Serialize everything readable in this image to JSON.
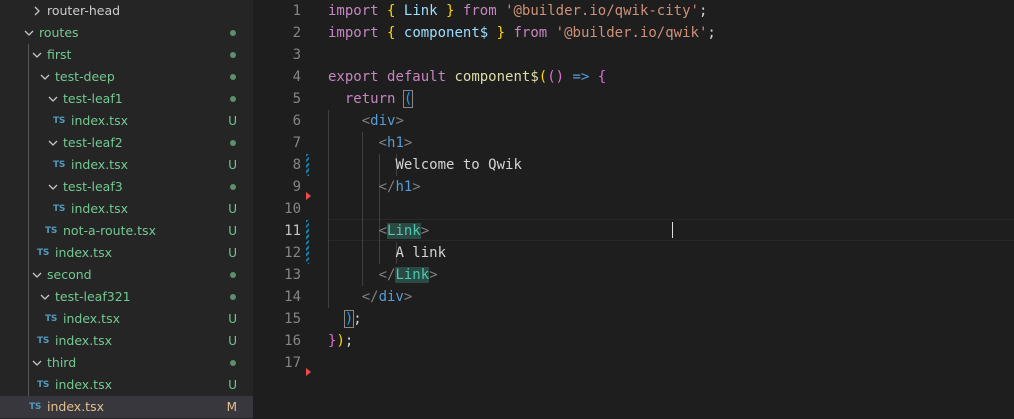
{
  "explorer": {
    "items": [
      {
        "label": "router-head",
        "kind": "folder",
        "expanded": false,
        "depth": 1,
        "state": "plain",
        "badge": ""
      },
      {
        "label": "routes",
        "kind": "folder",
        "expanded": true,
        "depth": 1,
        "state": "folder",
        "badge": "dot"
      },
      {
        "label": "first",
        "kind": "folder",
        "expanded": true,
        "depth": 2,
        "state": "folder",
        "badge": "dot"
      },
      {
        "label": "test-deep",
        "kind": "folder",
        "expanded": true,
        "depth": 3,
        "state": "folder",
        "badge": "dot"
      },
      {
        "label": "test-leaf1",
        "kind": "folder",
        "expanded": true,
        "depth": 4,
        "state": "folder",
        "badge": "dot"
      },
      {
        "label": "index.tsx",
        "kind": "file",
        "icon": "TS",
        "depth": 5,
        "state": "untracked",
        "badge": "U"
      },
      {
        "label": "test-leaf2",
        "kind": "folder",
        "expanded": true,
        "depth": 4,
        "state": "folder",
        "badge": "dot"
      },
      {
        "label": "index.tsx",
        "kind": "file",
        "icon": "TS",
        "depth": 5,
        "state": "untracked",
        "badge": "U"
      },
      {
        "label": "test-leaf3",
        "kind": "folder",
        "expanded": true,
        "depth": 4,
        "state": "folder",
        "badge": "dot"
      },
      {
        "label": "index.tsx",
        "kind": "file",
        "icon": "TS",
        "depth": 5,
        "state": "untracked",
        "badge": "U"
      },
      {
        "label": "not-a-route.tsx",
        "kind": "file",
        "icon": "TS",
        "depth": 4,
        "state": "untracked",
        "badge": "U"
      },
      {
        "label": "index.tsx",
        "kind": "file",
        "icon": "TS",
        "depth": 3,
        "state": "untracked",
        "badge": "U"
      },
      {
        "label": "second",
        "kind": "folder",
        "expanded": true,
        "depth": 2,
        "state": "folder",
        "badge": "dot"
      },
      {
        "label": "test-leaf321",
        "kind": "folder",
        "expanded": true,
        "depth": 3,
        "state": "folder",
        "badge": "dot"
      },
      {
        "label": "index.tsx",
        "kind": "file",
        "icon": "TS",
        "depth": 4,
        "state": "untracked",
        "badge": "U"
      },
      {
        "label": "index.tsx",
        "kind": "file",
        "icon": "TS",
        "depth": 3,
        "state": "untracked",
        "badge": "U"
      },
      {
        "label": "third",
        "kind": "folder",
        "expanded": true,
        "depth": 2,
        "state": "folder",
        "badge": "dot"
      },
      {
        "label": "index.tsx",
        "kind": "file",
        "icon": "TS",
        "depth": 3,
        "state": "untracked",
        "badge": "U"
      },
      {
        "label": "index.tsx",
        "kind": "file",
        "icon": "TS",
        "depth": 2,
        "state": "modified",
        "badge": "M",
        "selected": true
      }
    ]
  },
  "editor": {
    "language": "tsx",
    "active_line": 11,
    "line_numbers": [
      "1",
      "2",
      "3",
      "4",
      "5",
      "6",
      "7",
      "8",
      "9",
      "10",
      "11",
      "12",
      "13",
      "14",
      "15",
      "16",
      "17"
    ],
    "lines": [
      "import { Link } from '@builder.io/qwik-city';",
      "import { component$ } from '@builder.io/qwik';",
      "",
      "export default component$(() => {",
      "  return (",
      "    <div>",
      "      <h1>",
      "        Welcome to Qwik",
      "      </h1>",
      "",
      "      <Link>",
      "        A link",
      "      </Link>",
      "    </div>",
      "  );",
      "});",
      ""
    ],
    "tokens": {
      "import": "import",
      "from": "from",
      "export": "export",
      "default": "default",
      "return": "return",
      "link_id": "Link",
      "component_id": "component$",
      "str_qwik_city": "'@builder.io/qwik-city'",
      "str_qwik": "'@builder.io/qwik'",
      "arrow": "=>",
      "div": "div",
      "h1": "h1",
      "welcome": "Welcome to Qwik",
      "a_link": "A link"
    }
  },
  "colors": {
    "sidebar_bg": "#252526",
    "editor_bg": "#1e1e1e",
    "untracked": "#73c991",
    "modified": "#e2c08d",
    "ts_icon": "#519aba",
    "keyword": "#c586c0",
    "string": "#ce9178",
    "tag": "#569cd6",
    "component": "#4ec9b0"
  }
}
